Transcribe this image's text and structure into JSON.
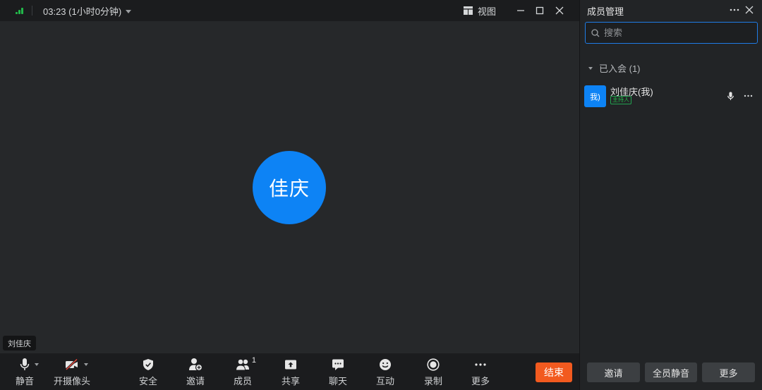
{
  "topbar": {
    "timer": "03:23 (1小时0分钟)",
    "view_label": "视图"
  },
  "stage": {
    "avatar_text": "佳庆",
    "name_tag": "刘佳庆"
  },
  "toolbar": {
    "mute": "静音",
    "camera": "开摄像头",
    "security": "安全",
    "invite": "邀请",
    "members": "成员",
    "members_count": "1",
    "share": "共享",
    "chat": "聊天",
    "interact": "互动",
    "record": "录制",
    "more": "更多",
    "end": "结束"
  },
  "panel": {
    "title": "成员管理",
    "search_placeholder": "搜索",
    "group_label": "已入会 (1)",
    "member": {
      "avatar": "我)",
      "name": "刘佳庆(我)",
      "role": "主持人"
    },
    "footer": {
      "invite": "邀请",
      "mute_all": "全员静音",
      "more": "更多"
    }
  },
  "colors": {
    "accent": "#0d83f5",
    "end": "#f25a1f",
    "host_badge": "#22b84a",
    "signal": "#22b84a"
  }
}
